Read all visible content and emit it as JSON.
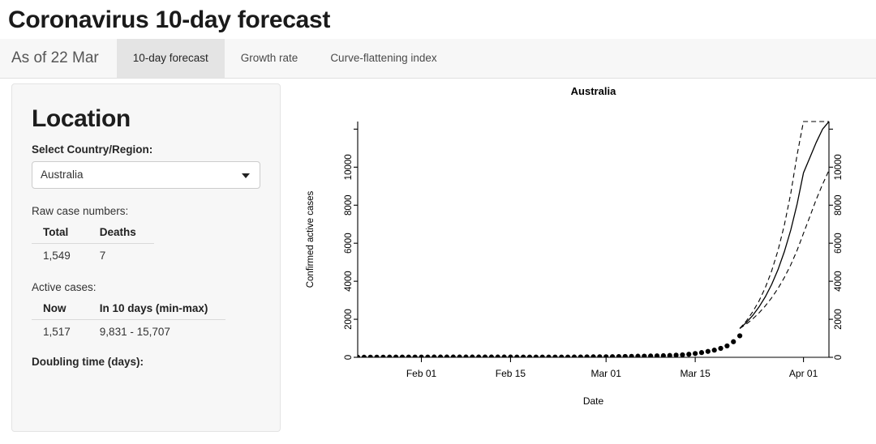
{
  "header": {
    "title": "Coronavirus 10-day forecast"
  },
  "tabs": [
    {
      "label": "As of 22 Mar",
      "active": false,
      "style": "first"
    },
    {
      "label": "10-day forecast",
      "active": true,
      "style": "normal"
    },
    {
      "label": "Growth rate",
      "active": false,
      "style": "normal"
    },
    {
      "label": "Curve-flattening index",
      "active": false,
      "style": "normal"
    }
  ],
  "sidebar": {
    "heading": "Location",
    "select_label": "Select Country/Region:",
    "select_value": "Australia",
    "select_options": [
      "Australia"
    ],
    "raw_cases": {
      "label": "Raw case numbers:",
      "headers": [
        "Total",
        "Deaths"
      ],
      "row": [
        "1,549",
        "7"
      ]
    },
    "active_cases": {
      "label": "Active cases:",
      "headers": [
        "Now",
        "In 10 days (min-max)"
      ],
      "row": [
        "1,517",
        "9,831 - 15,707"
      ]
    },
    "doubling_label": "Doubling time (days):"
  },
  "chart_data": {
    "type": "line",
    "title": "Australia",
    "xlabel": "Date",
    "ylabel": "Confirmed active cases",
    "grid": false,
    "legend": "none",
    "ylim": [
      0,
      12400
    ],
    "y_ticks": [
      0,
      2000,
      4000,
      6000,
      8000,
      10000
    ],
    "y_ticks_unlabeled": [
      12000
    ],
    "right_axis": true,
    "right_y_ticks": [
      0,
      2000,
      4000,
      6000,
      8000,
      10000
    ],
    "x_tick_labels": [
      "Feb 01",
      "Feb 15",
      "Mar 01",
      "Mar 15",
      "Apr 01"
    ],
    "x_tick_days": [
      10,
      24,
      39,
      53,
      70
    ],
    "xlim_days": [
      0,
      74
    ],
    "series": [
      {
        "name": "Observed active cases",
        "style": "points",
        "x": [
          0,
          1,
          2,
          3,
          4,
          5,
          6,
          7,
          8,
          9,
          10,
          11,
          12,
          13,
          14,
          15,
          16,
          17,
          18,
          19,
          20,
          21,
          22,
          23,
          24,
          25,
          26,
          27,
          28,
          29,
          30,
          31,
          32,
          33,
          34,
          35,
          36,
          37,
          38,
          39,
          40,
          41,
          42,
          43,
          44,
          45,
          46,
          47,
          48,
          49,
          50,
          51,
          52,
          53,
          54,
          55,
          56,
          57,
          58,
          59,
          60
        ],
        "values": [
          4,
          5,
          6,
          7,
          9,
          10,
          11,
          12,
          12,
          13,
          13,
          14,
          15,
          15,
          15,
          15,
          15,
          15,
          15,
          15,
          15,
          15,
          15,
          15,
          15,
          14,
          14,
          14,
          13,
          13,
          13,
          13,
          13,
          14,
          15,
          18,
          22,
          25,
          28,
          30,
          33,
          38,
          44,
          50,
          57,
          62,
          68,
          75,
          85,
          95,
          112,
          130,
          160,
          198,
          250,
          310,
          378,
          470,
          600,
          820,
          1130,
          1517
        ]
      },
      {
        "name": "Forecast mean",
        "style": "line",
        "x": [
          60,
          61,
          62,
          63,
          64,
          65,
          66,
          67,
          68,
          69,
          70,
          71,
          72,
          73,
          74
        ],
        "values": [
          1517,
          1820,
          2190,
          2640,
          3180,
          3830,
          4610,
          5560,
          6690,
          8060,
          9700,
          10500,
          11300,
          12000,
          12400
        ]
      },
      {
        "name": "Forecast upper bound",
        "style": "dashed",
        "x": [
          60,
          61,
          62,
          63,
          64,
          65,
          66,
          67,
          68,
          69,
          70,
          71,
          72,
          73,
          74
        ],
        "values": [
          1517,
          1900,
          2380,
          2950,
          3660,
          4540,
          5620,
          6960,
          8610,
          10650,
          12400,
          12400,
          12400,
          12400,
          12400
        ]
      },
      {
        "name": "Forecast lower bound",
        "style": "dashed",
        "x": [
          60,
          61,
          62,
          63,
          64,
          65,
          66,
          67,
          68,
          69,
          70,
          71,
          72,
          73,
          74
        ],
        "values": [
          1517,
          1740,
          2010,
          2330,
          2700,
          3130,
          3620,
          4200,
          4860,
          5630,
          6520,
          7400,
          8300,
          9100,
          9831
        ]
      }
    ]
  }
}
